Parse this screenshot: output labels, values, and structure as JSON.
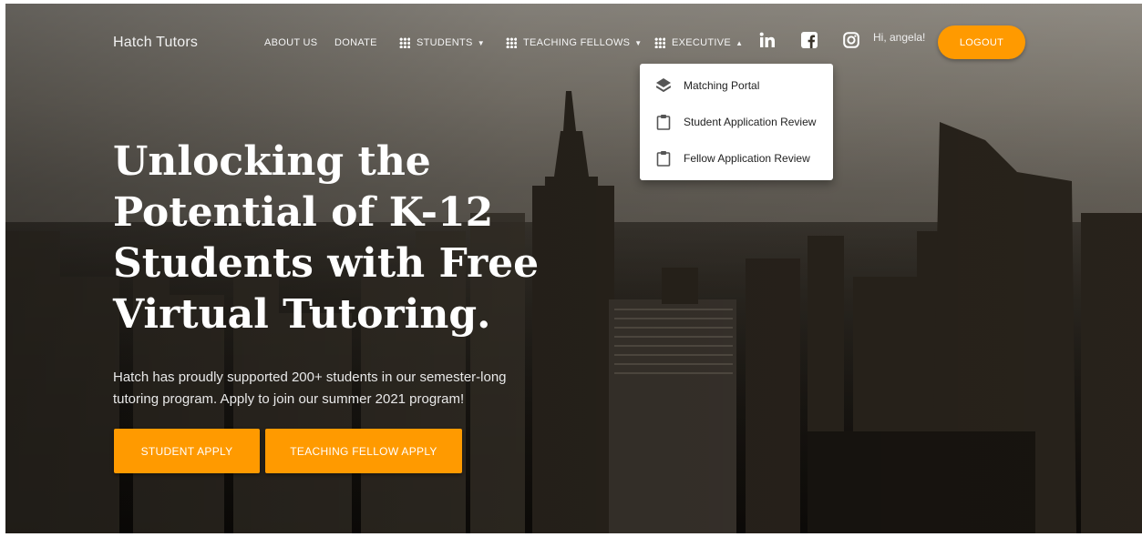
{
  "navbar": {
    "brand": "Hatch Tutors",
    "links": {
      "about": "ABOUT US",
      "donate": "DONATE",
      "students": "STUDENTS",
      "teaching_fellows": "TEACHING FELLOWS",
      "executive": "EXECUTIVE"
    },
    "social_icons": [
      "linkedin-icon",
      "facebook-icon",
      "instagram-icon"
    ],
    "greeting": "Hi, angela!",
    "logout": "LOGOUT"
  },
  "executive_menu": {
    "items": [
      {
        "label": "Matching Portal",
        "icon": "layers-icon"
      },
      {
        "label": "Student Application Review",
        "icon": "clipboard-icon"
      },
      {
        "label": "Fellow Application Review",
        "icon": "clipboard-icon"
      }
    ]
  },
  "hero": {
    "headline": "Unlocking the Potential of K-12 Students with Free Virtual Tutoring.",
    "subtext": "Hatch has proudly supported 200+ students in our semester-long tutoring program. Apply to join our summer 2021 program!",
    "student_apply": "STUDENT APPLY",
    "fellow_apply": "TEACHING FELLOW APPLY"
  },
  "colors": {
    "accent": "#ff9a00",
    "menu_background": "#ffffff"
  }
}
